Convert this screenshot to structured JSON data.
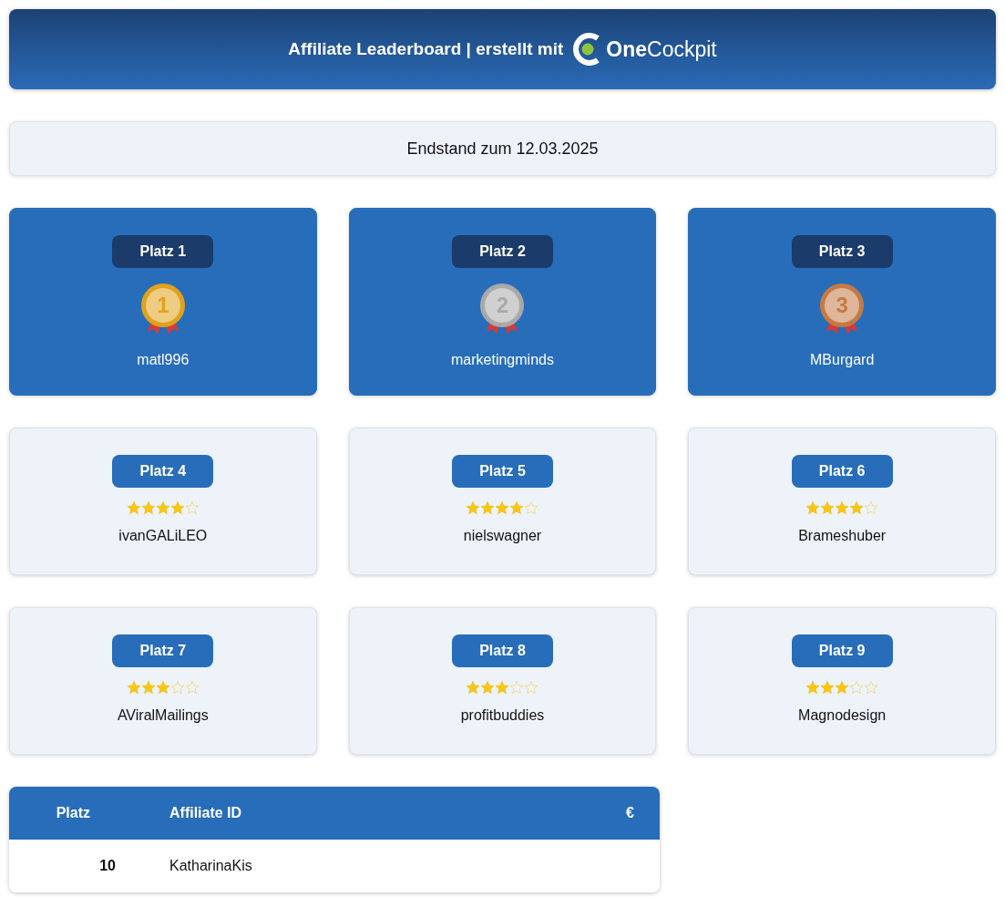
{
  "header": {
    "title": "Affiliate Leaderboard | erstellt mit",
    "logo": "**One**Cockpit"
  },
  "status": "Endstand zum 12.03.2025",
  "cards": [
    {
      "kind": "podium",
      "rank": "Platz 1",
      "color": "#e0a21c",
      "medal_number": "1",
      "name": "matl996"
    },
    {
      "kind": "podium",
      "rank": "Platz 2",
      "color": "#a9a9a9",
      "medal_number": "2",
      "name": "marketingminds"
    },
    {
      "kind": "podium",
      "rank": "Platz 3",
      "color": "#c57a45",
      "medal_number": "3",
      "name": "MBurgard"
    },
    {
      "kind": "rated",
      "rank": "Platz 4",
      "stars": 4,
      "name": "ivanGALiLEO"
    },
    {
      "kind": "rated",
      "rank": "Platz 5",
      "stars": 4,
      "name": "nielswagner"
    },
    {
      "kind": "rated",
      "rank": "Platz 6",
      "stars": 4,
      "name": "Brameshuber"
    },
    {
      "kind": "rated",
      "rank": "Platz 7",
      "stars": 3,
      "name": "AViralMailings"
    },
    {
      "kind": "rated",
      "rank": "Platz 8",
      "stars": 3,
      "name": "profitbuddies"
    },
    {
      "kind": "rated",
      "rank": "Platz 9",
      "stars": 3,
      "name": "Magnodesign"
    }
  ],
  "table": {
    "columns": [
      "Platz",
      "Affiliate ID",
      "€"
    ],
    "rows": [
      {
        "rank": "10",
        "name": "KatharinaKis"
      }
    ]
  }
}
